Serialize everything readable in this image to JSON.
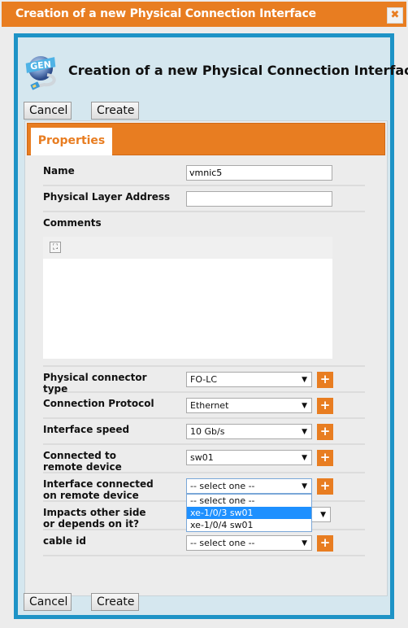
{
  "window": {
    "title": "Creation of a new Physical Connection Interface",
    "close_label": "✖"
  },
  "header": {
    "title": "Creation of a new Physical Connection Interface",
    "logo_text": "GEN"
  },
  "toolbar": {
    "cancel_label": "Cancel",
    "create_label": "Create"
  },
  "tabs": [
    {
      "label": "Properties",
      "active": true
    }
  ],
  "form": {
    "name": {
      "label": "Name",
      "value": "vmnic5"
    },
    "physical_layer_address": {
      "label": "Physical Layer Address",
      "value": ""
    },
    "comments": {
      "label": "Comments",
      "fullscreen_icon": "⛶"
    },
    "physical_connector_type": {
      "label": "Physical connector type",
      "value": "FO-LC"
    },
    "connection_protocol": {
      "label": "Connection Protocol",
      "value": "Ethernet"
    },
    "interface_speed": {
      "label": "Interface speed",
      "value": "10 Gb/s"
    },
    "connected_to_remote_device": {
      "label": "Connected to remote device",
      "value": "sw01"
    },
    "interface_connected_on_remote_device": {
      "label": "Interface connected on remote device",
      "value": "-- select one --",
      "options": [
        "-- select one --",
        "xe-1/0/3 sw01",
        "xe-1/0/4 sw01"
      ],
      "highlighted": "xe-1/0/3 sw01"
    },
    "impacts_other_side": {
      "label": "Impacts other side or depends on it?",
      "value": ""
    },
    "cable_id": {
      "label": "cable id",
      "value": "-- select one --"
    }
  },
  "icons": {
    "dropdown_arrow": "▼",
    "add": "+"
  },
  "colors": {
    "accent": "#e87d21",
    "frame": "#1e93c6",
    "highlight": "#1e90ff"
  }
}
